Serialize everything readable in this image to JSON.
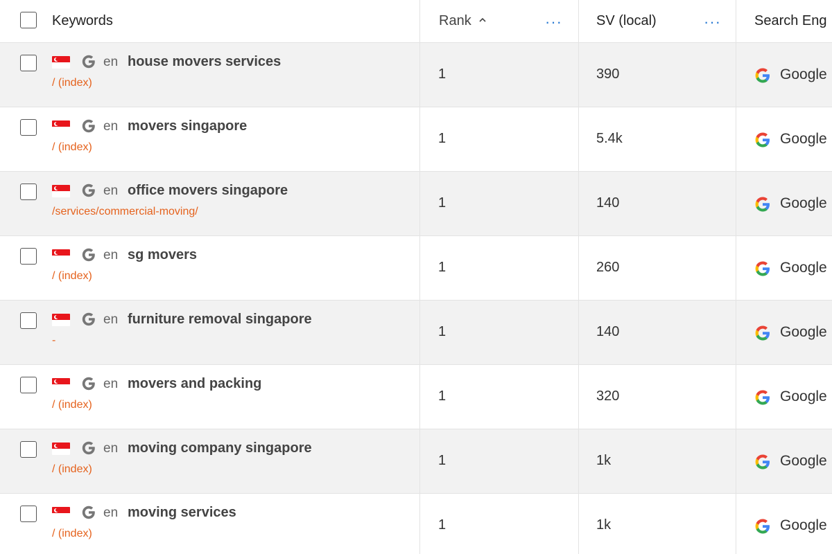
{
  "header": {
    "keywords": "Keywords",
    "rank": "Rank",
    "sv": "SV (local)",
    "search_engine": "Search Eng",
    "more": "···"
  },
  "rows": [
    {
      "lang": "en",
      "keyword": "house movers services",
      "url": "/ (index)",
      "rank": "1",
      "sv": "390",
      "engine": "Google"
    },
    {
      "lang": "en",
      "keyword": "movers singapore",
      "url": "/ (index)",
      "rank": "1",
      "sv": "5.4k",
      "engine": "Google"
    },
    {
      "lang": "en",
      "keyword": "office movers singapore",
      "url": "/services/commercial-moving/",
      "rank": "1",
      "sv": "140",
      "engine": "Google"
    },
    {
      "lang": "en",
      "keyword": "sg movers",
      "url": "/ (index)",
      "rank": "1",
      "sv": "260",
      "engine": "Google"
    },
    {
      "lang": "en",
      "keyword": "furniture removal singapore",
      "url": "-",
      "rank": "1",
      "sv": "140",
      "engine": "Google"
    },
    {
      "lang": "en",
      "keyword": "movers and packing",
      "url": "/ (index)",
      "rank": "1",
      "sv": "320",
      "engine": "Google"
    },
    {
      "lang": "en",
      "keyword": "moving company singapore",
      "url": "/ (index)",
      "rank": "1",
      "sv": "1k",
      "engine": "Google"
    },
    {
      "lang": "en",
      "keyword": "moving services",
      "url": "/ (index)",
      "rank": "1",
      "sv": "1k",
      "engine": "Google"
    }
  ],
  "icons": {
    "flag": "singapore-flag-icon",
    "gray_engine": "google-g-gray-icon",
    "color_engine": "google-g-color-icon",
    "sort": "chevron-up-icon"
  },
  "colors": {
    "url": "#e5621d",
    "more": "#2a7bd3",
    "row_shaded": "#f2f2f2",
    "flag_red": "#e8161c"
  }
}
